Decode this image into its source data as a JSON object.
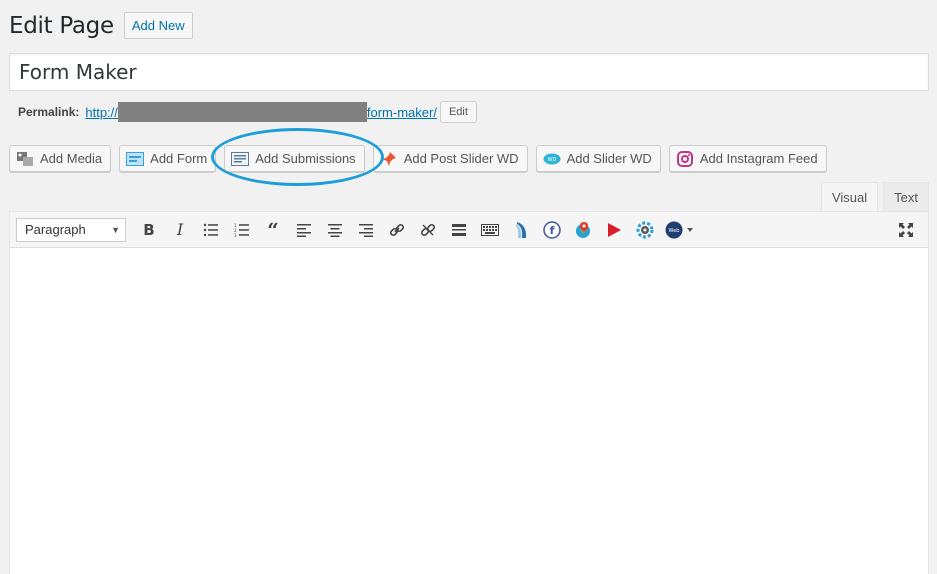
{
  "header": {
    "title": "Edit Page",
    "add_new": "Add New"
  },
  "post": {
    "title": "Form Maker"
  },
  "permalink": {
    "label": "Permalink:",
    "prefix": "http://",
    "suffix": "form-maker/",
    "edit": "Edit"
  },
  "media_buttons": [
    {
      "label": "Add Media",
      "icon": "media-icon"
    },
    {
      "label": "Add Form",
      "icon": "form-icon"
    },
    {
      "label": "Add Submissions",
      "icon": "submissions-icon"
    },
    {
      "label": "Add Post Slider WD",
      "icon": "pin-icon"
    },
    {
      "label": "Add Slider WD",
      "icon": "slider-icon"
    },
    {
      "label": "Add Instagram Feed",
      "icon": "instagram-icon"
    }
  ],
  "tabs": {
    "visual": "Visual",
    "text": "Text",
    "active": "Visual"
  },
  "toolbar": {
    "format": "Paragraph"
  },
  "colors": {
    "accent": "#0073aa",
    "highlight": "#1e9ed9"
  }
}
